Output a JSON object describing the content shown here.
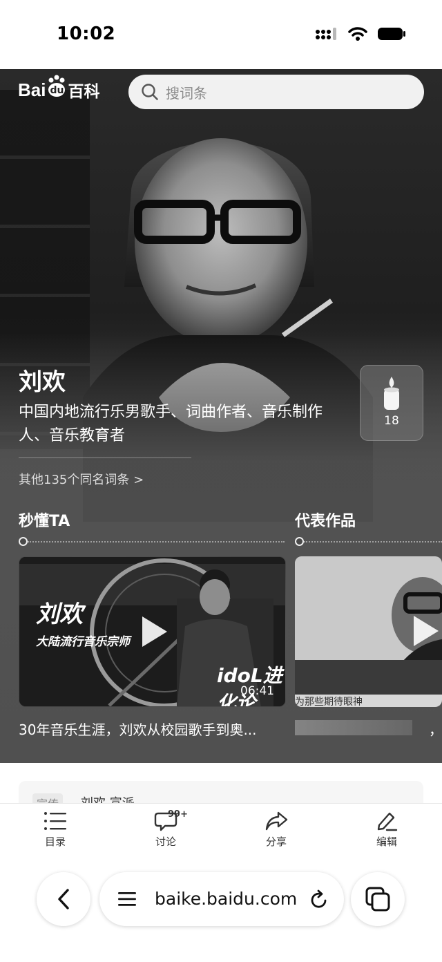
{
  "status_bar": {
    "time": "10:02"
  },
  "header": {
    "logo_text_bai": "Bai",
    "logo_text_du": "du",
    "logo_text_baike": "百科",
    "search_placeholder": "搜词条"
  },
  "entry": {
    "name": "刘欢",
    "description": "中国内地流行乐男歌手、词曲作者、音乐制作人、音乐教育者",
    "candle_count": "18",
    "same_name_link": "其他135个同名词条 >"
  },
  "sections": {
    "quick_title": "秒懂TA",
    "works_title": "代表作品"
  },
  "videos": [
    {
      "overlay_title": "刘欢",
      "overlay_subtitle": "大陆流行音乐宗师",
      "overlay_brand": "idoL进化论",
      "duration": "06:41",
      "caption": "30年音乐生涯，刘欢从校园歌手到奥..."
    },
    {
      "overlay_text": "为那些期待眼神",
      "caption": "，"
    }
  ],
  "content_card": {
    "tag": "宣传",
    "title": "刘欢 宣派"
  },
  "toolbar": {
    "toc_label": "目录",
    "discuss_label": "讨论",
    "discuss_badge": "99+",
    "share_label": "分享",
    "edit_label": "编辑"
  },
  "browser": {
    "url": "baike.baidu.com"
  }
}
